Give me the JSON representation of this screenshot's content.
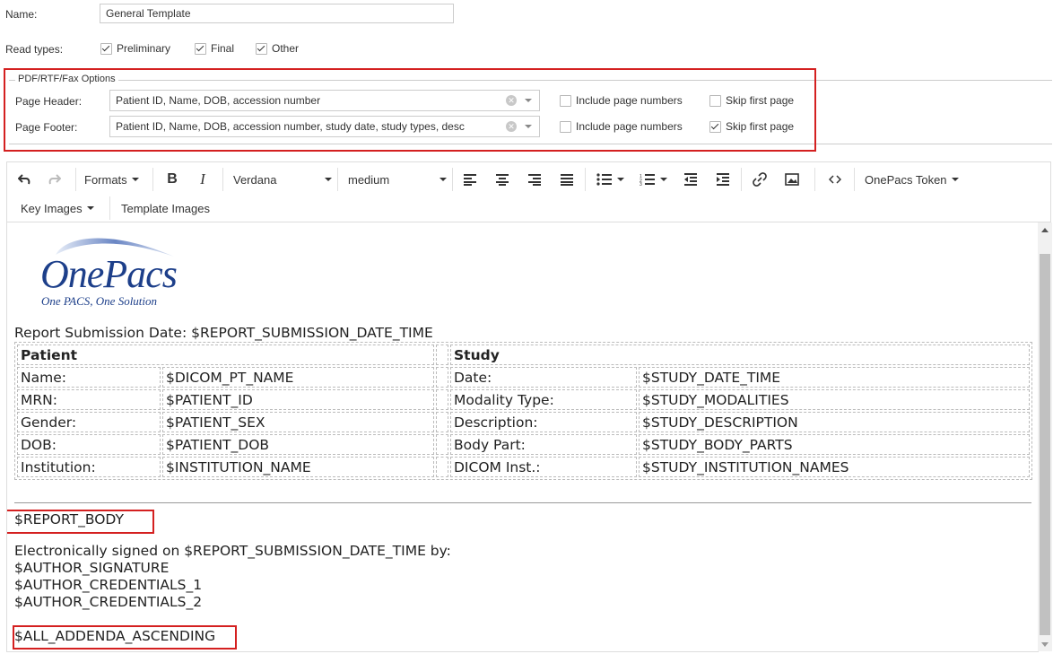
{
  "form": {
    "name_label": "Name:",
    "name_value": "General Template",
    "read_types_label": "Read types:",
    "read_types": [
      {
        "label": "Preliminary",
        "checked": true
      },
      {
        "label": "Final",
        "checked": true
      },
      {
        "label": "Other",
        "checked": true
      }
    ]
  },
  "pdf_options": {
    "legend": "PDF/RTF/Fax Options",
    "header_label": "Page Header:",
    "header_value": "Patient ID, Name, DOB, accession number",
    "footer_label": "Page Footer:",
    "footer_value": "Patient ID, Name, DOB, accession number, study date, study types, desc",
    "include_page_numbers": "Include page numbers",
    "skip_first_page": "Skip first page",
    "header_include_checked": false,
    "header_skip_checked": false,
    "footer_include_checked": false,
    "footer_skip_checked": true
  },
  "toolbar": {
    "formats": "Formats",
    "bold": "B",
    "italic": "I",
    "font": "Verdana",
    "size": "medium",
    "token": "OnePacs Token",
    "key_images": "Key Images",
    "template_images": "Template Images"
  },
  "logo": {
    "name": "OnePacs",
    "tagline": "One PACS, One Solution"
  },
  "report": {
    "submission": "Report Submission Date: $REPORT_SUBMISSION_DATE_TIME",
    "patient_header": "Patient",
    "study_header": "Study",
    "rows": [
      {
        "pl": "Name:",
        "pv": "$DICOM_PT_NAME",
        "sl": "Date:",
        "sv": "$STUDY_DATE_TIME"
      },
      {
        "pl": "MRN:",
        "pv": "$PATIENT_ID",
        "sl": "Modality Type:",
        "sv": "$STUDY_MODALITIES"
      },
      {
        "pl": "Gender:",
        "pv": "$PATIENT_SEX",
        "sl": "Description:",
        "sv": "$STUDY_DESCRIPTION"
      },
      {
        "pl": "DOB:",
        "pv": "$PATIENT_DOB",
        "sl": "Body Part:",
        "sv": "$STUDY_BODY_PARTS"
      },
      {
        "pl": "Institution:",
        "pv": "$INSTITUTION_NAME",
        "sl": "DICOM Inst.:",
        "sv": "$STUDY_INSTITUTION_NAMES"
      }
    ],
    "body": "$REPORT_BODY",
    "signed": "Electronically signed on $REPORT_SUBMISSION_DATE_TIME by:",
    "signature": "$AUTHOR_SIGNATURE",
    "cred1": "$AUTHOR_CREDENTIALS_1",
    "cred2": "$AUTHOR_CREDENTIALS_2",
    "addenda": "$ALL_ADDENDA_ASCENDING"
  }
}
